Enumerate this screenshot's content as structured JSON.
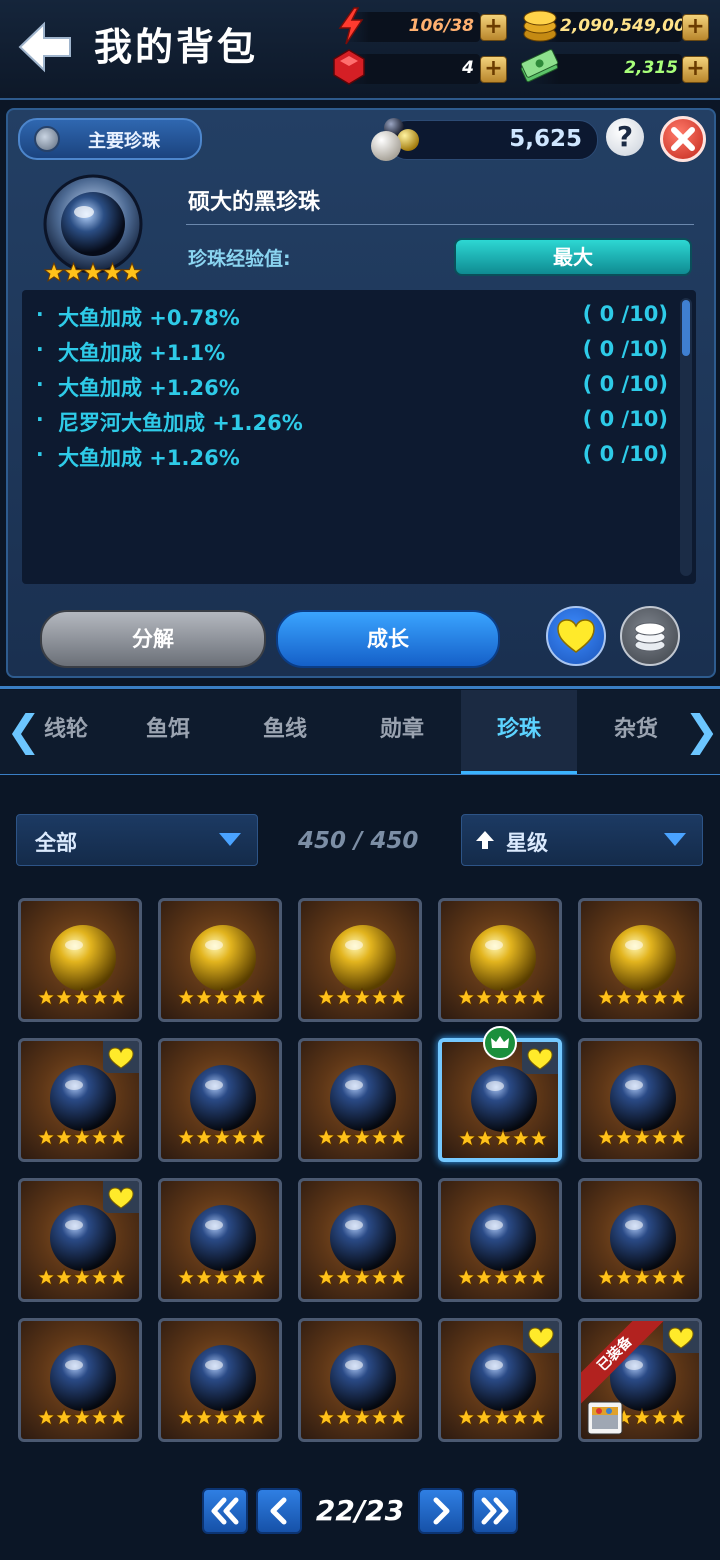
{
  "header": {
    "title": "我的背包",
    "energy": "106/38",
    "gold": "2,090,549,009",
    "gems": "4",
    "cash": "2,315"
  },
  "detail": {
    "main_pearl_label": "主要珍珠",
    "pearl_count": "5,625",
    "help_label": "?",
    "pearl_name": "硕大的黑珍珠",
    "exp_label": "珍珠经验值:",
    "exp_status": "最大",
    "stats": [
      {
        "text": "大鱼加成 +0.78%",
        "count": "( 0 /10)"
      },
      {
        "text": "大鱼加成 +1.1%",
        "count": "( 0 /10)"
      },
      {
        "text": "大鱼加成 +1.26%",
        "count": "( 0 /10)"
      },
      {
        "text": "尼罗河大鱼加成 +1.26%",
        "count": "( 0 /10)"
      },
      {
        "text": "大鱼加成 +1.26%",
        "count": "( 0 /10)"
      }
    ],
    "decompose_label": "分解",
    "grow_label": "成长"
  },
  "tabs": [
    {
      "label": "线轮"
    },
    {
      "label": "鱼饵"
    },
    {
      "label": "鱼线"
    },
    {
      "label": "勋章"
    },
    {
      "label": "珍珠",
      "active": true
    },
    {
      "label": "杂货"
    }
  ],
  "filters": {
    "category": "全部",
    "capacity": "450 / 450",
    "sort": "星级"
  },
  "grid": {
    "items": [
      {
        "pearl": "gold",
        "stars": 5
      },
      {
        "pearl": "gold",
        "stars": 5
      },
      {
        "pearl": "gold",
        "stars": 5
      },
      {
        "pearl": "gold",
        "stars": 5
      },
      {
        "pearl": "gold",
        "stars": 5
      },
      {
        "pearl": "black",
        "stars": 5,
        "favorite": true
      },
      {
        "pearl": "black",
        "stars": 5
      },
      {
        "pearl": "black",
        "stars": 5
      },
      {
        "pearl": "black",
        "stars": 5,
        "favorite": true,
        "selected": true,
        "crown": true
      },
      {
        "pearl": "black",
        "stars": 5
      },
      {
        "pearl": "black",
        "stars": 5,
        "favorite": true
      },
      {
        "pearl": "black",
        "stars": 5
      },
      {
        "pearl": "black",
        "stars": 5
      },
      {
        "pearl": "black",
        "stars": 5
      },
      {
        "pearl": "black",
        "stars": 5
      },
      {
        "pearl": "black",
        "stars": 5
      },
      {
        "pearl": "black",
        "stars": 5
      },
      {
        "pearl": "black",
        "stars": 5
      },
      {
        "pearl": "black",
        "stars": 5,
        "favorite": true
      },
      {
        "pearl": "black",
        "stars": 5,
        "favorite": true,
        "equipped": true
      }
    ],
    "equipped_label": "已装备"
  },
  "pagination": {
    "current": "22/23"
  },
  "colors": {
    "accent": "#3bb4ff",
    "star": "#ffc21a",
    "heart": "#ffea2a",
    "text_stat": "#2ecbe8"
  }
}
